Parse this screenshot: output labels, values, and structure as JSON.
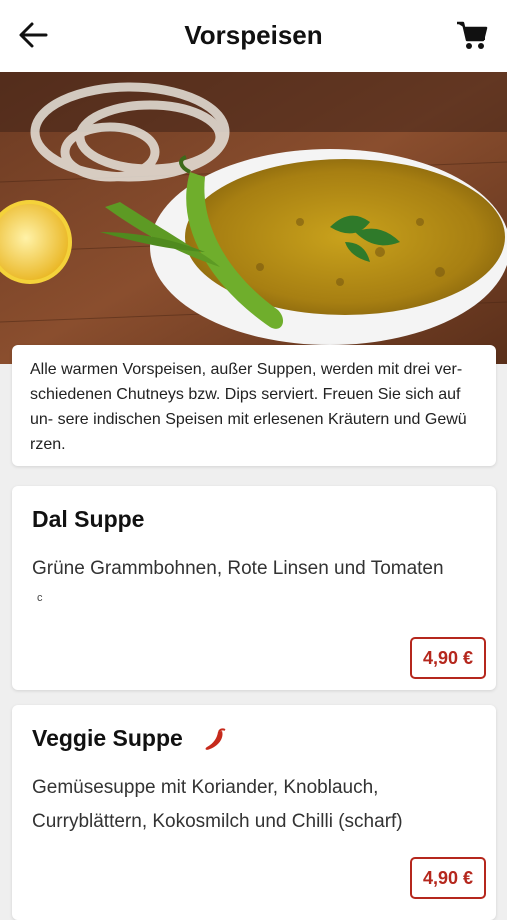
{
  "header": {
    "title": "Vorspeisen",
    "back_icon": "arrow-left-icon",
    "cart_icon": "shopping-cart-icon"
  },
  "intro": {
    "text": "Alle warmen Vorspeisen, außer Suppen, werden mit drei ver- schiedenen Chutneys bzw. Dips serviert. Freuen Sie sich auf un- sere indischen Speisen mit erlesenen Kräutern und Gewü rzen."
  },
  "items": [
    {
      "name": "Dal Suppe",
      "description": "Grüne Grammbohnen, Rote Linsen und Tomaten",
      "extra": "c",
      "price": "4,90 €",
      "spicy": false
    },
    {
      "name": "Veggie Suppe",
      "description": "Gemüsesuppe mit Koriander, Knoblauch, Curryblättern, Kokosmilch und Chilli (scharf)",
      "extra": "",
      "price": "4,90 €",
      "spicy": true
    }
  ],
  "colors": {
    "accent": "#b5271d",
    "background": "#efefef"
  }
}
